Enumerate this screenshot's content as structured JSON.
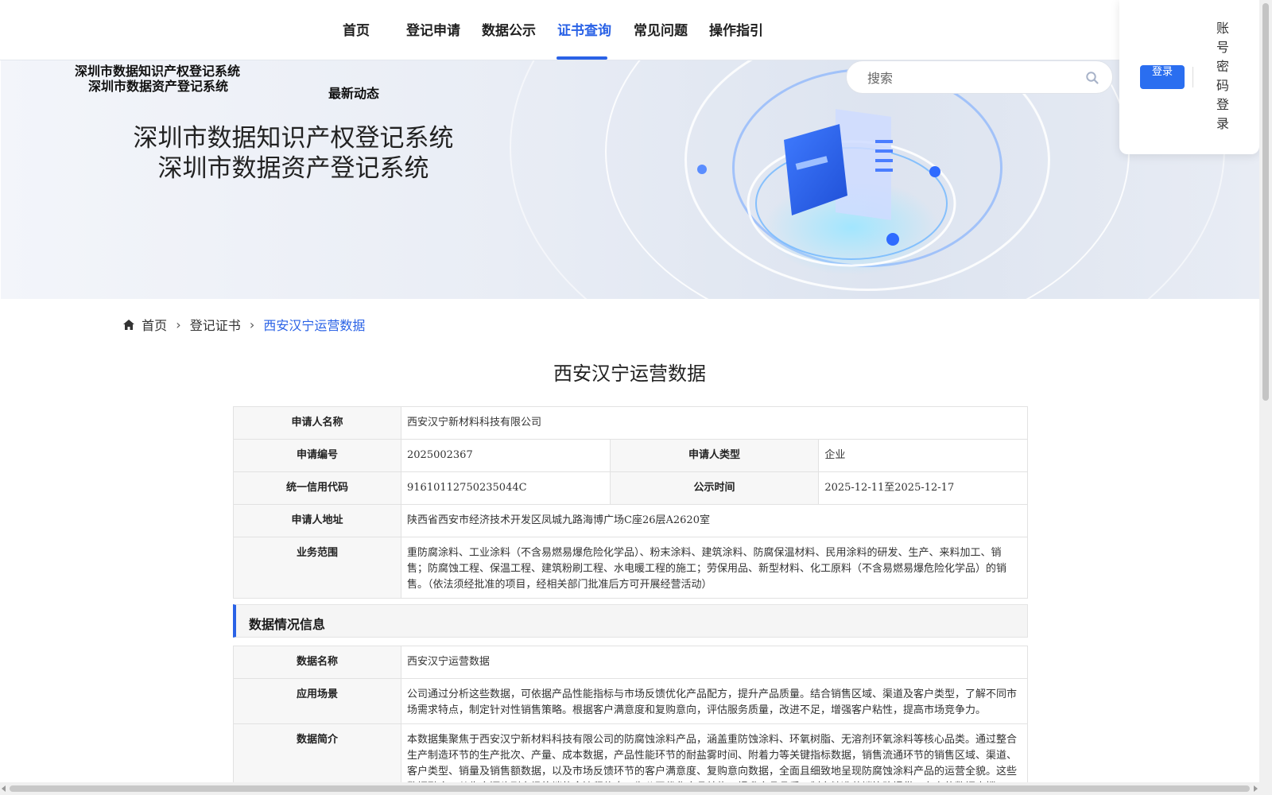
{
  "nav": {
    "items": [
      {
        "label": "首页"
      },
      {
        "label": "登记申请"
      },
      {
        "label": "数据公示"
      },
      {
        "label": "证书查询"
      },
      {
        "label": "常见问题"
      },
      {
        "label": "操作指引"
      }
    ],
    "active": "证书查询"
  },
  "login": {
    "button_label": "登录",
    "password_login": "账号密码登录"
  },
  "banner": {
    "small_title_1": "深圳市数据知识产权登记系统",
    "small_title_2": "深圳市数据资产登记系统",
    "latest": "最新动态",
    "big_title_1": "深圳市数据知识产权登记系统",
    "big_title_2": "深圳市数据资产登记系统",
    "search_placeholder": "搜索"
  },
  "breadcrumb": {
    "home": "首页",
    "level2": "登记证书",
    "current": "西安汉宁运营数据"
  },
  "page_title": "西安汉宁运营数据",
  "applicant": {
    "name_label": "申请人名称",
    "name_value": "西安汉宁新材料科技有限公司",
    "number_label": "申请编号",
    "number_value": "2025002367",
    "type_label": "申请人类型",
    "type_value": "企业",
    "credit_label": "统一信用代码",
    "credit_value": "91610112750235044C",
    "public_label": "公示时间",
    "public_value": "2025-12-11至2025-12-17",
    "address_label": "申请人地址",
    "address_value": "陕西省西安市经济技术开发区凤城九路海博广场C座26层A2620室",
    "scope_label": "业务范围",
    "scope_value": "重防腐涂料、工业涂料（不含易燃易爆危险化学品）、粉末涂料、建筑涂料、防腐保温材料、民用涂料的研发、生产、来料加工、销售；防腐蚀工程、保温工程、建筑粉刷工程、水电暖工程的施工；劳保用品、新型材料、化工原料（不含易燃易爆危险化学品）的销售。（依法须经批准的项目，经相关部门批准后方可开展经营活动）"
  },
  "data_section": {
    "title": "数据情况信息",
    "name_label": "数据名称",
    "name_value": "西安汉宁运营数据",
    "scene_label": "应用场景",
    "scene_value": "公司通过分析这些数据，可依据产品性能指标与市场反馈优化产品配方，提升产品质量。结合销售区域、渠道及客户类型，了解不同市场需求特点，制定针对性销售策略。根据客户满意度和复购意向，评估服务质量，改进不足，增强客户粘性，提高市场竞争力。",
    "intro_label": "数据简介",
    "intro_value": "本数据集聚焦于西安汉宁新材料科技有限公司的防腐蚀涂料产品，涵盖重防蚀涂料、环氧树脂、无溶剂环氧涂料等核心品类。通过整合生产制造环节的生产批次、产量、成本数据，产品性能环节的耐盐雾时间、附着力等关键指标数据，销售流通环节的销售区域、渠道、客户类型、销量及销售额数据，以及市场反馈环节的客户满意度、复购意向数据，全面且细致地呈现防腐蚀涂料产品的运营全貌。这些数据融合了从生产源头到市场终端的全流程信息，为公司优化产品结构、提升产品品质、制定精准营销策略提供了有力的数据支撑。"
  },
  "colors": {
    "accent": "#2a62e6",
    "login_button": "#2a6ef0"
  }
}
